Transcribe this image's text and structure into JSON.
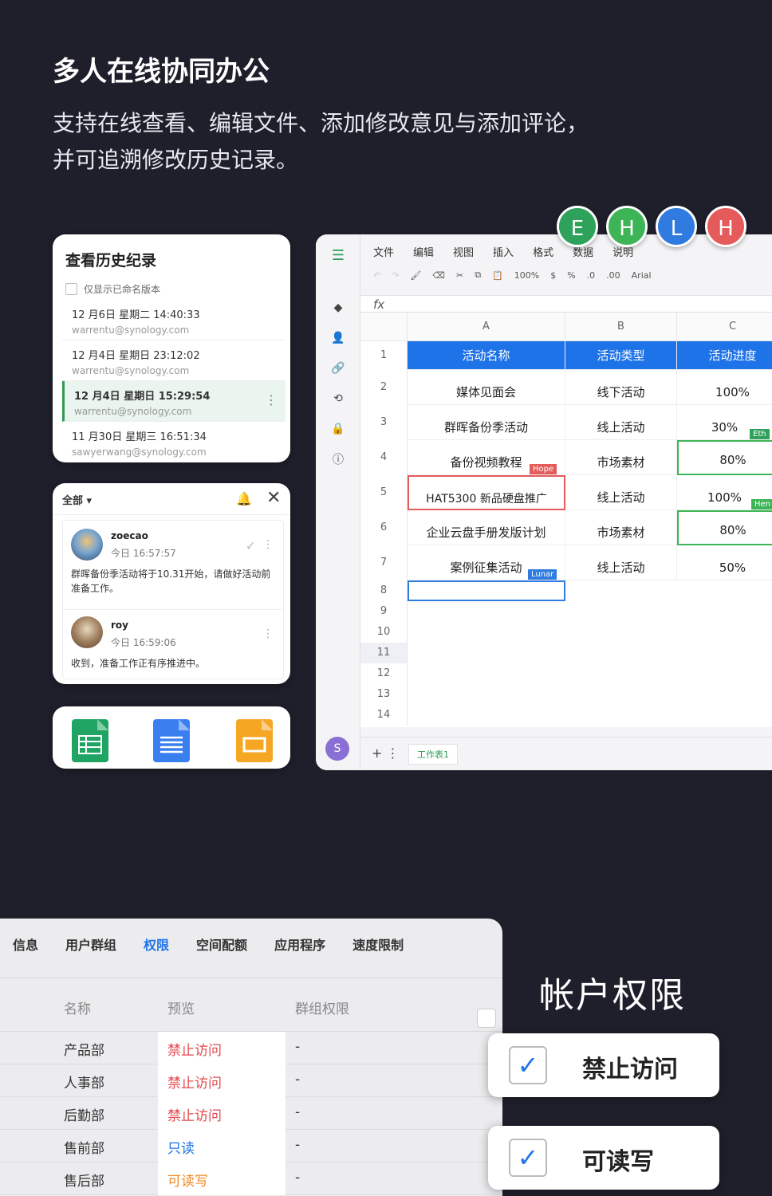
{
  "hero": {
    "title": "多人在线协同办公",
    "desc_line1": "支持在线查看、编辑文件、添加修改意见与添加评论，",
    "desc_line2": "并可追溯修改历史记录。"
  },
  "history": {
    "title": "查看历史纪录",
    "checkbox_label": "仅显示已命名版本",
    "items": [
      {
        "date": "12 月6日 星期二 14:40:33",
        "email": "warrentu@synology.com"
      },
      {
        "date": "12 月4日 星期日 23:12:02",
        "email": "warrentu@synology.com"
      },
      {
        "date": "12 月4日 星期日 15:29:54",
        "email": "warrentu@synology.com"
      },
      {
        "date": "11 月30日 星期三 16:51:34",
        "email": "sawyerwang@synology.com"
      }
    ]
  },
  "comments": {
    "filter": "全部",
    "items": [
      {
        "name": "zoecao",
        "time": "今日 16:57:57",
        "text": "群晖备份季活动将于10.31开始，请做好活动前准备工作。"
      },
      {
        "name": "roy",
        "time": "今日 16:59:06",
        "text": "收到，准备工作正有序推进中。"
      }
    ]
  },
  "apps": [
    {
      "name": "spreadsheet-app-icon",
      "color": "#1fa463"
    },
    {
      "name": "document-app-icon",
      "color": "#3a7ff0"
    },
    {
      "name": "slides-app-icon",
      "color": "#f5a623"
    }
  ],
  "collaborators": [
    {
      "letter": "E",
      "color": "#2ea25a"
    },
    {
      "letter": "H",
      "color": "#3db556"
    },
    {
      "letter": "L",
      "color": "#2f7be0"
    },
    {
      "letter": "H",
      "color": "#e55b5b"
    }
  ],
  "sheet": {
    "menu": [
      "文件",
      "编辑",
      "视图",
      "插入",
      "格式",
      "数据",
      "说明"
    ],
    "toolbar": {
      "zoom": "100%",
      "currency": "$",
      "percent": "%",
      "dec1": ".0",
      "dec2": ".00",
      "font": "Arial"
    },
    "fx": "fx",
    "columns": [
      "A",
      "B",
      "C"
    ],
    "header": [
      "活动名称",
      "活动类型",
      "活动进度"
    ],
    "rows": [
      [
        "媒体见面会",
        "线下活动",
        "100%"
      ],
      [
        "群晖备份季活动",
        "线上活动",
        "30%"
      ],
      [
        "备份视频教程",
        "市场素材",
        "80%"
      ],
      [
        "HAT5300 新品硬盘推广",
        "线上活动",
        "100%"
      ],
      [
        "企业云盘手册发版计划",
        "市场素材",
        "80%"
      ],
      [
        "案例征集活动",
        "线上活动",
        "50%"
      ]
    ],
    "row_numbers": [
      "1",
      "2",
      "3",
      "4",
      "5",
      "6",
      "7",
      "8",
      "9",
      "10",
      "11",
      "12",
      "13",
      "14"
    ],
    "cursors": {
      "hope": "Hope",
      "lunar": "Lunar",
      "eth": "Eth",
      "hen": "Hen"
    },
    "sheet_tab": "工作表1",
    "user_badge": "S"
  },
  "permissions": {
    "tabs": [
      "信息",
      "用户群组",
      "权限",
      "空间配额",
      "应用程序",
      "速度限制"
    ],
    "active_tab": "权限",
    "columns": [
      "名称",
      "预览",
      "群组权限"
    ],
    "rows": [
      {
        "name": "产品部",
        "preview": "禁止访问",
        "group": "-",
        "color": "#e5484d"
      },
      {
        "name": "人事部",
        "preview": "禁止访问",
        "group": "-",
        "color": "#e5484d"
      },
      {
        "name": "后勤部",
        "preview": "禁止访问",
        "group": "-",
        "color": "#e5484d"
      },
      {
        "name": "售前部",
        "preview": "只读",
        "group": "-",
        "color": "#1e73e8"
      },
      {
        "name": "售后部",
        "preview": "可读写",
        "group": "-",
        "color": "#f08a24"
      }
    ]
  },
  "account": {
    "title": "帐户权限",
    "options": [
      "禁止访问",
      "可读写"
    ]
  }
}
